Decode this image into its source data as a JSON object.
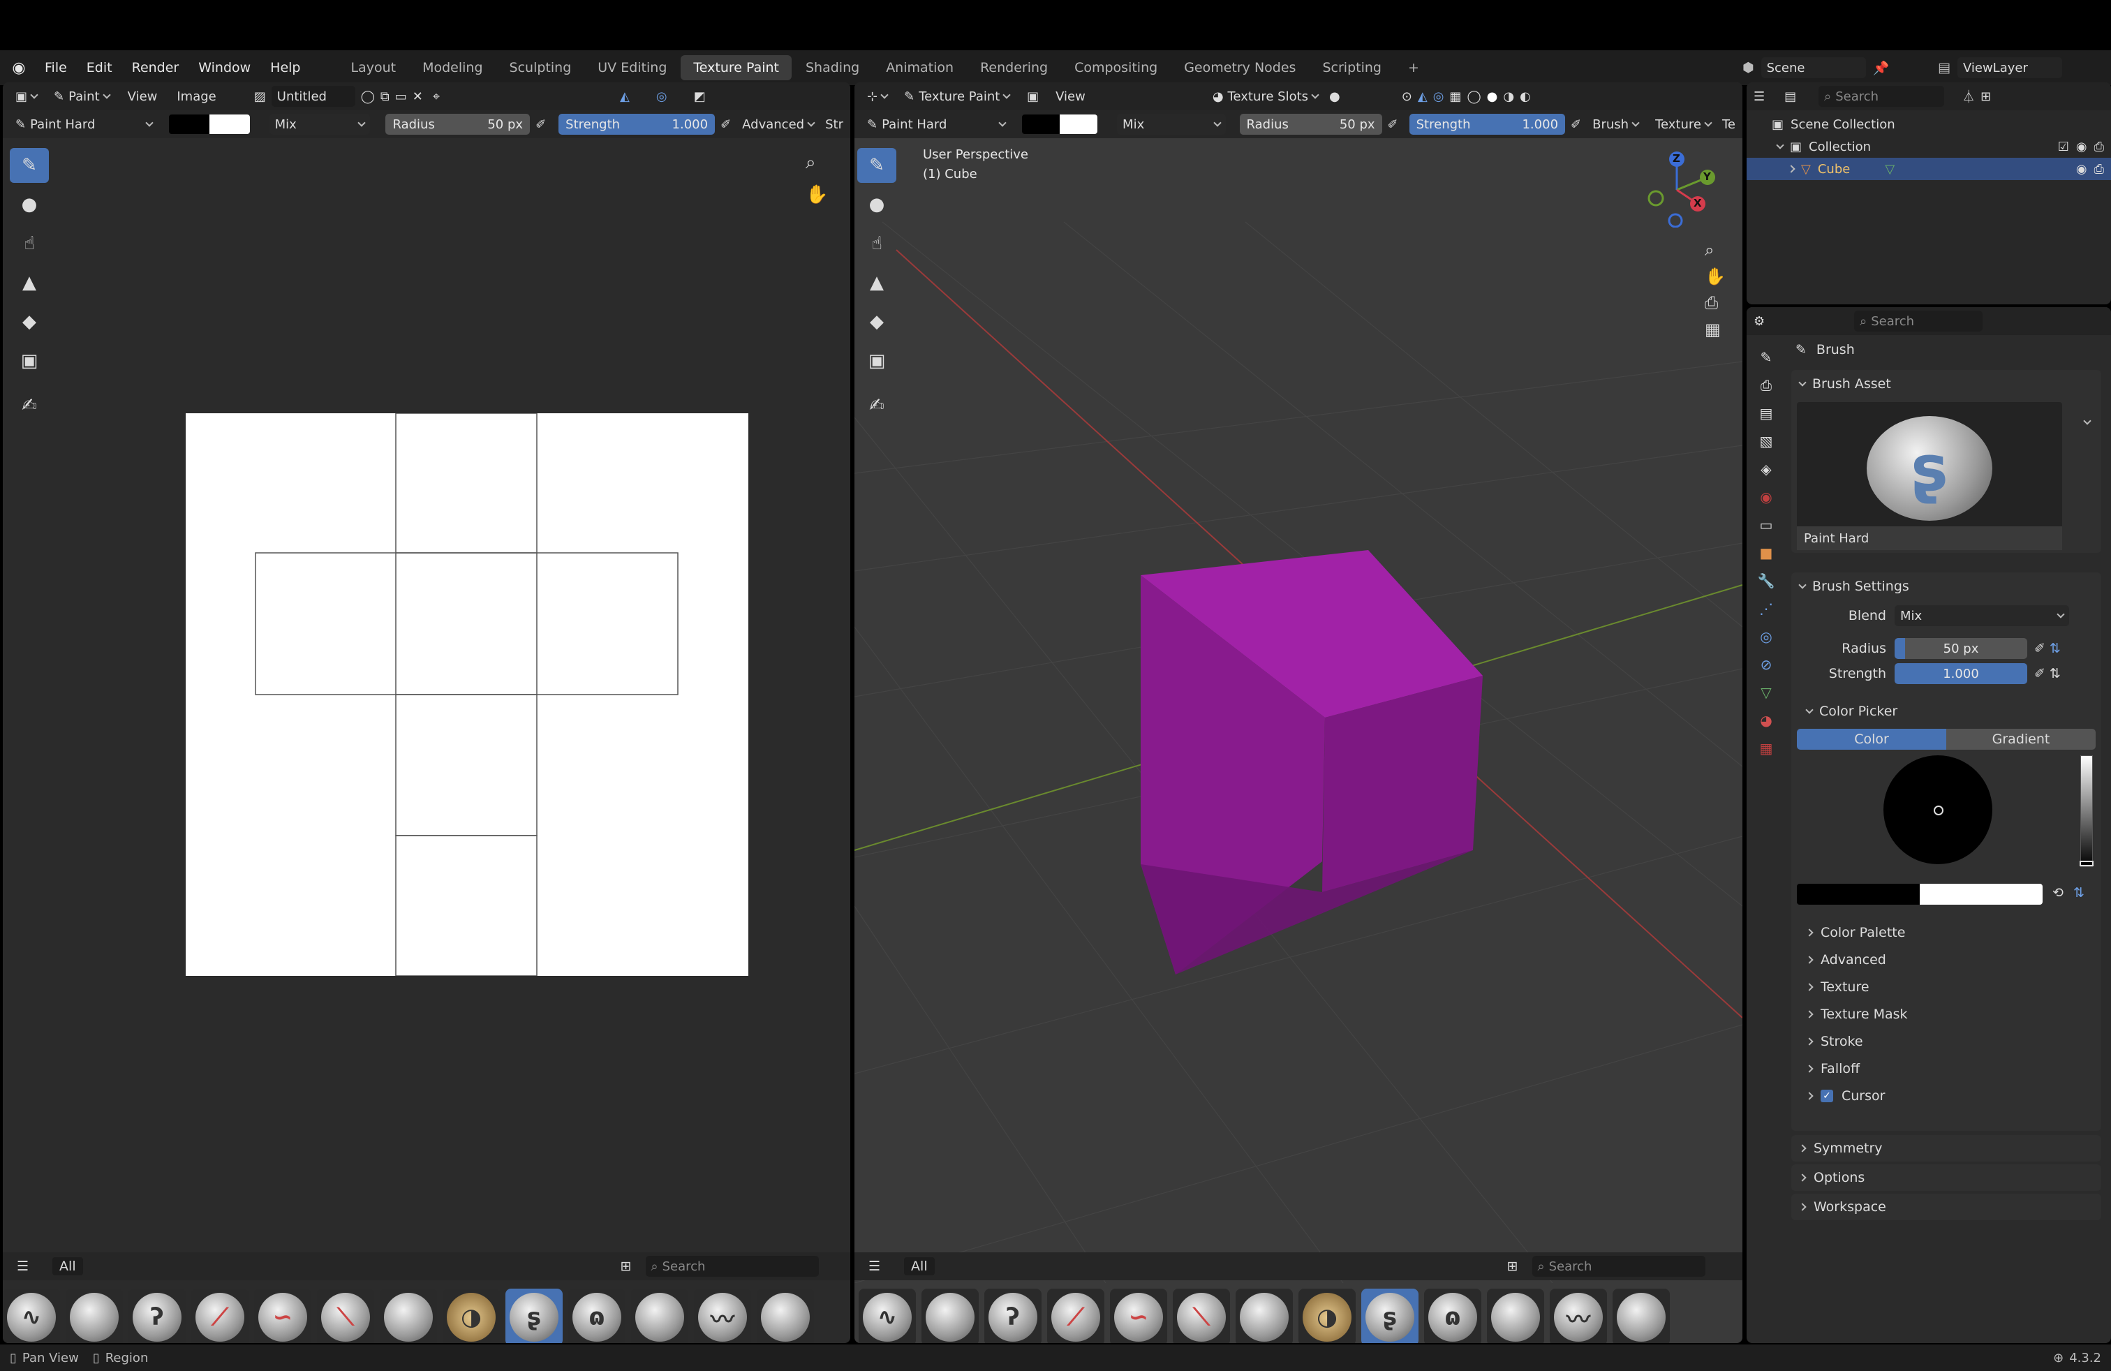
{
  "menu": {
    "items": [
      "File",
      "Edit",
      "Render",
      "Window",
      "Help"
    ]
  },
  "workspaces": [
    "Layout",
    "Modeling",
    "Sculpting",
    "UV Editing",
    "Texture Paint",
    "Shading",
    "Animation",
    "Rendering",
    "Compositing",
    "Geometry Nodes",
    "Scripting"
  ],
  "active_workspace": "Texture Paint",
  "scene": {
    "label": "Scene",
    "viewlayer": "ViewLayer"
  },
  "image_editor": {
    "mode": "Paint",
    "view": "View",
    "image": "Image",
    "image_name": "Untitled",
    "brush": "Paint Hard",
    "blend": "Mix",
    "radius_label": "Radius",
    "radius": "50 px",
    "strength_label": "Strength",
    "strength": "1.000",
    "advanced": "Advanced",
    "stroke": "Str",
    "shelf_all": "All",
    "shelf_search": "Search"
  },
  "viewport": {
    "mode": "Texture Paint",
    "view": "View",
    "slots": "Texture Slots",
    "brush": "Paint Hard",
    "blend": "Mix",
    "radius_label": "Radius",
    "radius": "50 px",
    "strength_label": "Strength",
    "strength": "1.000",
    "brush_menu": "Brush",
    "texture_menu": "Texture",
    "trunc": "Te",
    "persp": "User Perspective",
    "object": "(1) Cube",
    "gizmo": {
      "z": "Z",
      "y": "Y",
      "x": "X"
    },
    "shelf_all": "All",
    "shelf_search": "Search",
    "cube_color": "#8e1c92"
  },
  "outliner": {
    "search": "Search",
    "scene_collection": "Scene Collection",
    "collection": "Collection",
    "cube": "Cube"
  },
  "properties": {
    "search": "Search",
    "title": "Brush",
    "brush_asset": "Brush Asset",
    "asset_name": "Paint Hard",
    "brush_settings": "Brush Settings",
    "blend_label": "Blend",
    "blend": "Mix",
    "radius_label": "Radius",
    "radius": "50 px",
    "strength_label": "Strength",
    "strength": "1.000",
    "color_picker": "Color Picker",
    "tab_color": "Color",
    "tab_gradient": "Gradient",
    "subpanels": [
      "Color Palette",
      "Advanced",
      "Texture",
      "Texture Mask",
      "Stroke",
      "Falloff",
      "Cursor"
    ],
    "panels": [
      "Symmetry",
      "Options",
      "Workspace"
    ]
  },
  "status": {
    "pan": "Pan View",
    "region": "Region",
    "version": "4.3.2"
  },
  "colors": {
    "accent": "#4772b3",
    "bg": "#303030",
    "header": "#1e1e1e"
  }
}
